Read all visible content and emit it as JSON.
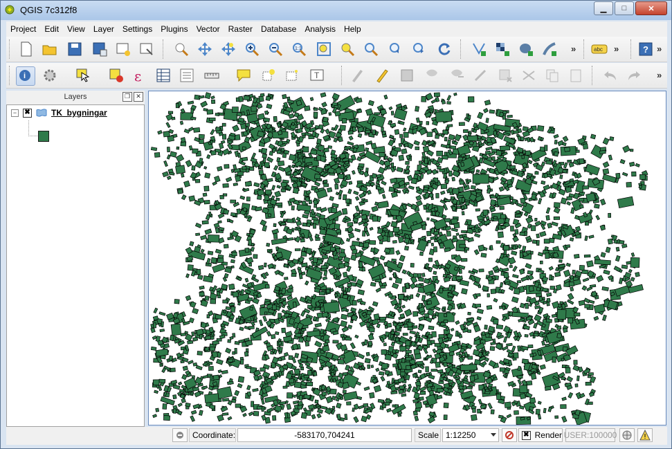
{
  "window": {
    "title": "QGIS 7c312f8"
  },
  "menubar": {
    "items": [
      "Project",
      "Edit",
      "View",
      "Layer",
      "Settings",
      "Plugins",
      "Vector",
      "Raster",
      "Database",
      "Analysis",
      "Help"
    ]
  },
  "layers_panel": {
    "title": "Layers",
    "expander": "−",
    "checkbox": "✖",
    "layers": [
      {
        "name": "TK_bygningar",
        "color": "#2f7a4a"
      }
    ]
  },
  "toolbar": {
    "label_tool_text": "abc",
    "help_text": "?",
    "overflow": "»"
  },
  "map": {
    "feature_fill": "#2f7a4a",
    "feature_stroke": "#000000",
    "background": "#ffffff"
  },
  "statusbar": {
    "coordinate_label": "Coordinate:",
    "coordinate_value": "-583170,704241",
    "scale_label": "Scale",
    "scale_value": "1:12250",
    "render_label": "Render",
    "render_checkbox": "✖",
    "user_label": "USER:100000"
  }
}
